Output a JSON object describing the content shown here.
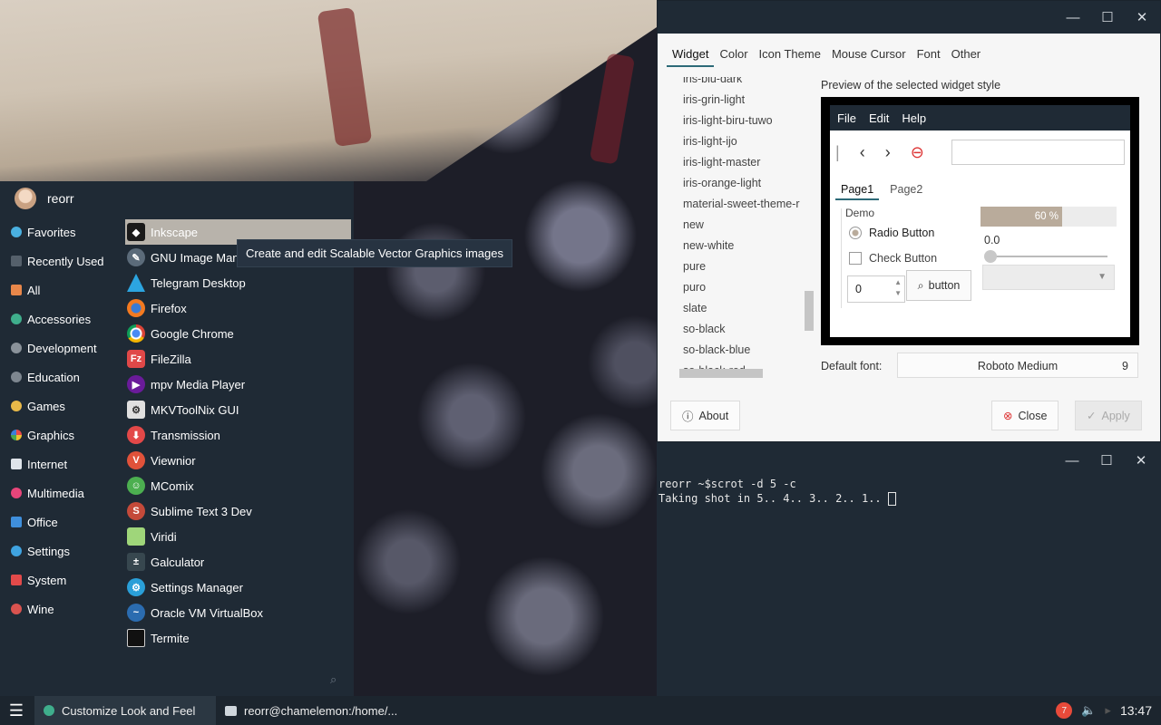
{
  "menu": {
    "username": "reorr",
    "categories": [
      "Favorites",
      "Recently Used",
      "All",
      "Accessories",
      "Development",
      "Education",
      "Games",
      "Graphics",
      "Internet",
      "Multimedia",
      "Office",
      "Settings",
      "System",
      "Wine"
    ],
    "apps": [
      "Inkscape",
      "GNU Image Mani",
      "Telegram Desktop",
      "Firefox",
      "Google Chrome",
      "FileZilla",
      "mpv Media Player",
      "MKVToolNix GUI",
      "Transmission",
      "Viewnior",
      "MComix",
      "Sublime Text 3 Dev",
      "Viridi",
      "Galculator",
      "Settings Manager",
      "Oracle VM VirtualBox",
      "Termite"
    ],
    "tooltip": "Create and edit Scalable Vector Graphics images"
  },
  "settings": {
    "tabs": [
      "Widget",
      "Color",
      "Icon Theme",
      "Mouse Cursor",
      "Font",
      "Other"
    ],
    "themes": [
      "iris-blu-dark",
      "iris-grin-light",
      "iris-light-biru-tuwo",
      "iris-light-ijo",
      "iris-light-master",
      "iris-orange-light",
      "material-sweet-theme-r",
      "new",
      "new-white",
      "pure",
      "puro",
      "slate",
      "so-black",
      "so-black-blue",
      "so-black-red"
    ],
    "preview_label": "Preview of the selected widget style",
    "preview": {
      "menu": [
        "File",
        "Edit",
        "Help"
      ],
      "tabs": [
        "Page1",
        "Page2"
      ],
      "frame_label": "Demo",
      "radio": "Radio Button",
      "check": "Check Button",
      "spin_value": "0",
      "button": "button",
      "progress": 0.6,
      "progress_label": "60 %",
      "slider_value": "0.0"
    },
    "font_label": "Default font:",
    "font_name": "Roboto Medium",
    "font_size": "9",
    "about": "About",
    "close": "Close",
    "apply": "Apply"
  },
  "terminal": {
    "line1": "reorr ~$scrot -d 5 -c",
    "line2": "Taking shot in 5.. 4.. 3.. 2.. 1.. "
  },
  "taskbar": {
    "task1": "Customize Look and Feel",
    "task2": "reorr@chamelemon:/home/...",
    "badge": "7",
    "clock": "13:47"
  }
}
